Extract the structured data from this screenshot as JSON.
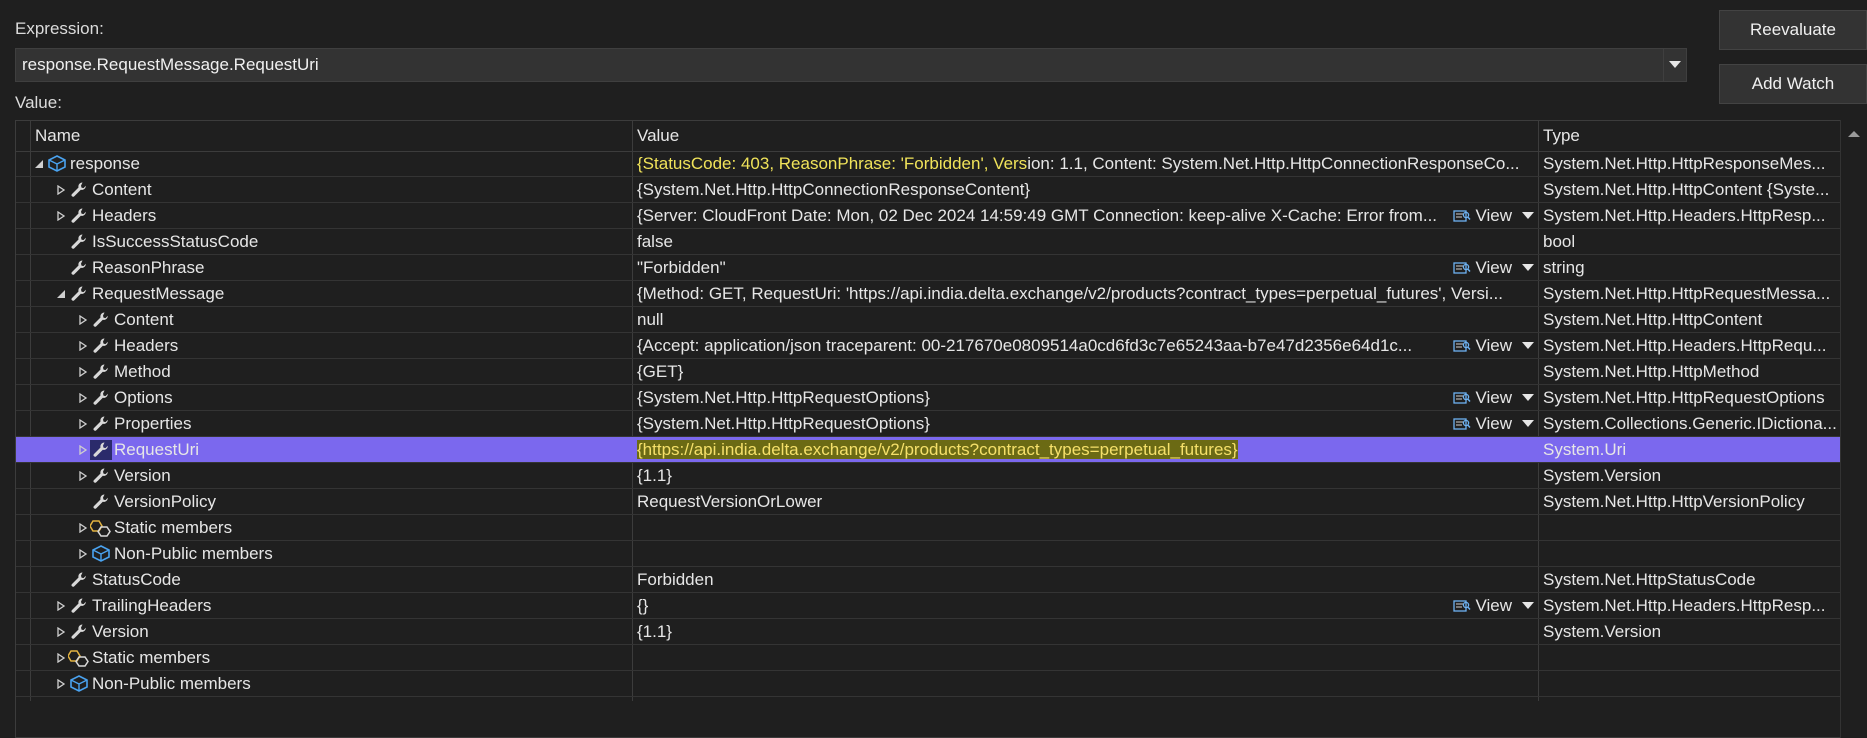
{
  "expression": {
    "label": "Expression:",
    "value": "response.RequestMessage.RequestUri",
    "dropdown_icon": "chevron-down-icon"
  },
  "value_label": "Value:",
  "buttons": {
    "reevaluate": "Reevaluate",
    "add_watch": "Add Watch"
  },
  "columns": {
    "name": "Name",
    "value": "Value",
    "type": "Type"
  },
  "colors": {
    "selection": "#7b68ee",
    "highlight_text": "#f0e35a",
    "background": "#1f1f1f"
  },
  "view_label": "View",
  "rows": [
    {
      "level": 0,
      "expander": "expanded",
      "icon": "object-icon",
      "name": "response",
      "value": "{StatusCode: 403, ReasonPhrase: 'Forbidden', Version: 1.1, Content: System.Net.Http.HttpConnectionResponseCo...",
      "type": "System.Net.Http.HttpResponseMes...",
      "value_style": "partial-yellow",
      "value_yellow": "{StatusCode: 403, ReasonPhrase: 'Forbidden', Vers",
      "value_rest": "ion: 1.1, Content: System.Net.Http.HttpConnectionResponseCo..."
    },
    {
      "level": 1,
      "expander": "collapsed",
      "icon": "wrench-icon",
      "name": "Content",
      "value": "{System.Net.Http.HttpConnectionResponseContent}",
      "type": "System.Net.Http.HttpContent {Syste..."
    },
    {
      "level": 1,
      "expander": "collapsed",
      "icon": "wrench-icon",
      "name": "Headers",
      "value": "{Server: CloudFront Date: Mon, 02 Dec 2024 14:59:49 GMT Connection: keep-alive X-Cache: Error from...",
      "type": "System.Net.Http.Headers.HttpResp...",
      "view": true
    },
    {
      "level": 1,
      "expander": "none",
      "icon": "wrench-icon",
      "name": "IsSuccessStatusCode",
      "value": "false",
      "type": "bool"
    },
    {
      "level": 1,
      "expander": "none",
      "icon": "wrench-icon",
      "name": "ReasonPhrase",
      "value": "\"Forbidden\"",
      "type": "string",
      "view": true
    },
    {
      "level": 1,
      "expander": "expanded",
      "icon": "wrench-icon",
      "name": "RequestMessage",
      "value": "{Method: GET, RequestUri: 'https://api.india.delta.exchange/v2/products?contract_types=perpetual_futures', Versi...",
      "type": "System.Net.Http.HttpRequestMessa..."
    },
    {
      "level": 2,
      "expander": "collapsed",
      "icon": "wrench-icon",
      "name": "Content",
      "value": "null",
      "type": "System.Net.Http.HttpContent"
    },
    {
      "level": 2,
      "expander": "collapsed",
      "icon": "wrench-icon",
      "name": "Headers",
      "value": "{Accept: application/json traceparent: 00-217670e0809514a0cd6fd3c7e65243aa-b7e47d2356e64d1c...",
      "type": "System.Net.Http.Headers.HttpRequ...",
      "view": true
    },
    {
      "level": 2,
      "expander": "collapsed",
      "icon": "wrench-icon",
      "name": "Method",
      "value": "{GET}",
      "type": "System.Net.Http.HttpMethod"
    },
    {
      "level": 2,
      "expander": "collapsed",
      "icon": "wrench-icon",
      "name": "Options",
      "value": "{System.Net.Http.HttpRequestOptions}",
      "type": "System.Net.Http.HttpRequestOptions",
      "view": true
    },
    {
      "level": 2,
      "expander": "collapsed",
      "icon": "wrench-icon",
      "name": "Properties",
      "value": "{System.Net.Http.HttpRequestOptions}",
      "type": "System.Collections.Generic.IDictiona...",
      "view": true
    },
    {
      "level": 2,
      "expander": "collapsed",
      "icon": "wrench-icon",
      "name": "RequestUri",
      "value": "{https://api.india.delta.exchange/v2/products?contract_types=perpetual_futures}",
      "type": "System.Uri",
      "selected": true
    },
    {
      "level": 2,
      "expander": "collapsed",
      "icon": "wrench-icon",
      "name": "Version",
      "value": "{1.1}",
      "type": "System.Version"
    },
    {
      "level": 2,
      "expander": "none",
      "icon": "wrench-icon",
      "name": "VersionPolicy",
      "value": "RequestVersionOrLower",
      "type": "System.Net.Http.HttpVersionPolicy"
    },
    {
      "level": 2,
      "expander": "collapsed",
      "icon": "static-members-icon",
      "name": "Static members",
      "value": "",
      "type": ""
    },
    {
      "level": 2,
      "expander": "collapsed",
      "icon": "object-icon",
      "name": "Non-Public members",
      "value": "",
      "type": ""
    },
    {
      "level": 1,
      "expander": "none",
      "icon": "wrench-icon",
      "name": "StatusCode",
      "value": "Forbidden",
      "type": "System.Net.HttpStatusCode"
    },
    {
      "level": 1,
      "expander": "collapsed",
      "icon": "wrench-icon",
      "name": "TrailingHeaders",
      "value": "{}",
      "type": "System.Net.Http.Headers.HttpResp...",
      "view": true
    },
    {
      "level": 1,
      "expander": "collapsed",
      "icon": "wrench-icon",
      "name": "Version",
      "value": "{1.1}",
      "type": "System.Version"
    },
    {
      "level": 1,
      "expander": "collapsed",
      "icon": "static-members-icon",
      "name": "Static members",
      "value": "",
      "type": ""
    },
    {
      "level": 1,
      "expander": "collapsed",
      "icon": "object-icon",
      "name": "Non-Public members",
      "value": "",
      "type": ""
    }
  ]
}
